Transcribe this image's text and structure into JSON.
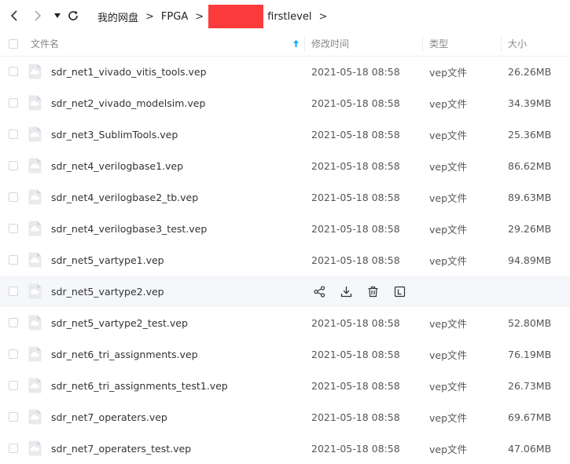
{
  "breadcrumb": {
    "root": "我的网盘",
    "items": [
      "FPGA",
      "firstlevel"
    ],
    "separator": ">"
  },
  "table": {
    "headers": {
      "name": "文件名",
      "modified": "修改时间",
      "type": "类型",
      "size": "大小"
    },
    "sort_icon": "arrow-up-icon",
    "hover_actions": [
      "share-icon",
      "download-icon",
      "delete-icon",
      "more-icon"
    ],
    "rows": [
      {
        "name": "sdr_net1_vivado_vitis_tools.vep",
        "date": "2021-05-18 08:58",
        "type": "vep文件",
        "size": "26.26MB"
      },
      {
        "name": "sdr_net2_vivado_modelsim.vep",
        "date": "2021-05-18 08:58",
        "type": "vep文件",
        "size": "34.39MB"
      },
      {
        "name": "sdr_net3_SublimTools.vep",
        "date": "2021-05-18 08:58",
        "type": "vep文件",
        "size": "25.36MB"
      },
      {
        "name": "sdr_net4_verilogbase1.vep",
        "date": "2021-05-18 08:58",
        "type": "vep文件",
        "size": "86.62MB"
      },
      {
        "name": "sdr_net4_verilogbase2_tb.vep",
        "date": "2021-05-18 08:58",
        "type": "vep文件",
        "size": "89.63MB"
      },
      {
        "name": "sdr_net4_verilogbase3_test.vep",
        "date": "2021-05-18 08:58",
        "type": "vep文件",
        "size": "29.26MB"
      },
      {
        "name": "sdr_net5_vartype1.vep",
        "date": "2021-05-18 08:58",
        "type": "vep文件",
        "size": "94.89MB"
      },
      {
        "name": "sdr_net5_vartype2.vep",
        "date": "",
        "type": "",
        "size": "",
        "hover": true
      },
      {
        "name": "sdr_net5_vartype2_test.vep",
        "date": "2021-05-18 08:58",
        "type": "vep文件",
        "size": "52.80MB"
      },
      {
        "name": "sdr_net6_tri_assignments.vep",
        "date": "2021-05-18 08:58",
        "type": "vep文件",
        "size": "76.19MB"
      },
      {
        "name": "sdr_net6_tri_assignments_test1.vep",
        "date": "2021-05-18 08:58",
        "type": "vep文件",
        "size": "26.73MB"
      },
      {
        "name": "sdr_net7_operaters.vep",
        "date": "2021-05-18 08:58",
        "type": "vep文件",
        "size": "69.67MB"
      },
      {
        "name": "sdr_net7_operaters_test.vep",
        "date": "2021-05-18 08:58",
        "type": "vep文件",
        "size": "47.06MB"
      }
    ]
  },
  "colors": {
    "accent": "#06a7ff",
    "redaction": "#fb3b3b",
    "hover_row": "#f5f7fa"
  }
}
